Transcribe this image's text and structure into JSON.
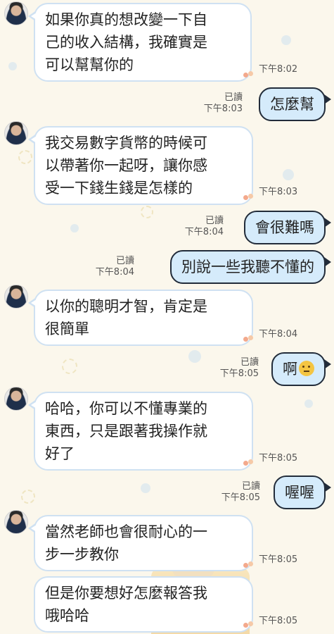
{
  "chat": {
    "read_label": "已讀",
    "messages": [
      {
        "side": "in",
        "lines": [
          "如果你真的想改變一下自",
          "己的收入結構，我確實是",
          "可以幫幫你的"
        ],
        "time": "下午8:02"
      },
      {
        "side": "out",
        "text": "怎麼幫",
        "time": "下午8:03"
      },
      {
        "side": "in",
        "lines": [
          "我交易數字貨幣的時候可",
          "以帶著你一起呀，讓你感",
          "受一下錢生錢是怎樣的"
        ],
        "time": "下午8:03"
      },
      {
        "side": "out",
        "text": "會很難嗎",
        "time": "下午8:04"
      },
      {
        "side": "out",
        "text": "別說一些我聽不懂的",
        "time": "下午8:04"
      },
      {
        "side": "in",
        "lines": [
          "以你的聰明才智，肯定是",
          "很簡單"
        ],
        "time": "下午8:04"
      },
      {
        "side": "out",
        "text": "啊",
        "time": "下午8:05",
        "emoji": "thinking-face-emoji"
      },
      {
        "side": "in",
        "lines": [
          "哈哈，你可以不懂專業的",
          "東西，只是跟著我操作就",
          "好了"
        ],
        "time": "下午8:05"
      },
      {
        "side": "out",
        "text": "喔喔",
        "time": "下午8:05"
      },
      {
        "side": "in",
        "lines": [
          "當然老師也會很耐心的一",
          "步一步教你"
        ],
        "time": "下午8:05"
      },
      {
        "side": "in",
        "lines": [
          "但是你要想好怎麼報答我",
          "哦哈哈"
        ],
        "time": "下午8:05"
      }
    ]
  }
}
